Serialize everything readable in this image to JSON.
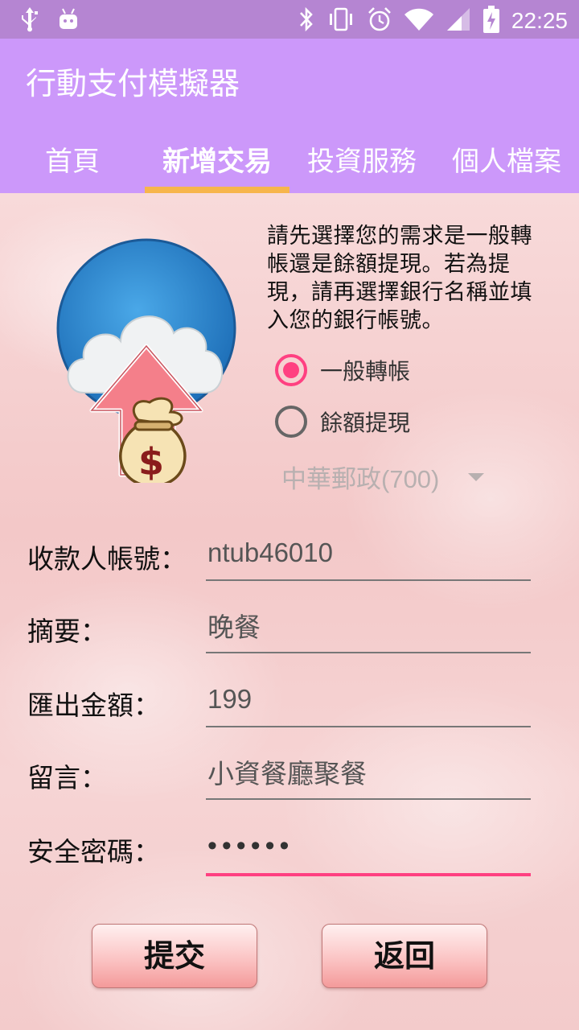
{
  "status_bar": {
    "time": "22:25",
    "left_icons": [
      "usb-icon",
      "android-icon"
    ],
    "right_icons": [
      "bluetooth-icon",
      "vibrate-icon",
      "alarm-icon",
      "wifi-icon",
      "signal-icon",
      "battery-charging-icon"
    ]
  },
  "app": {
    "title": "行動支付模擬器"
  },
  "tabs": [
    {
      "label": "首頁"
    },
    {
      "label": "新增交易"
    },
    {
      "label": "投資服務"
    },
    {
      "label": "個人檔案"
    }
  ],
  "active_tab_index": 1,
  "instructions": "請先選擇您的需求是一般轉帳還是餘額提現。若為提現，請再選擇銀行名稱並填入您的銀行帳號。",
  "transfer_type": {
    "options": [
      {
        "label": "一般轉帳",
        "checked": true
      },
      {
        "label": "餘額提現",
        "checked": false
      }
    ]
  },
  "bank_select": {
    "value": "中華郵政(700)",
    "enabled": false
  },
  "form": {
    "account": {
      "label": "收款人帳號：",
      "value": "ntub46010"
    },
    "memo": {
      "label": "摘要：",
      "value": "晚餐"
    },
    "amount": {
      "label": "匯出金額：",
      "value": "199"
    },
    "message": {
      "label": "留言：",
      "value": "小資餐廳聚餐"
    },
    "password": {
      "label": "安全密碼：",
      "value": "••••••"
    }
  },
  "buttons": {
    "submit": "提交",
    "back": "返回"
  },
  "colors": {
    "status_bar": "#b585d2",
    "toolbar": "#cc98fa",
    "tab_indicator": "#f7b54c",
    "accent": "#ff4081"
  }
}
